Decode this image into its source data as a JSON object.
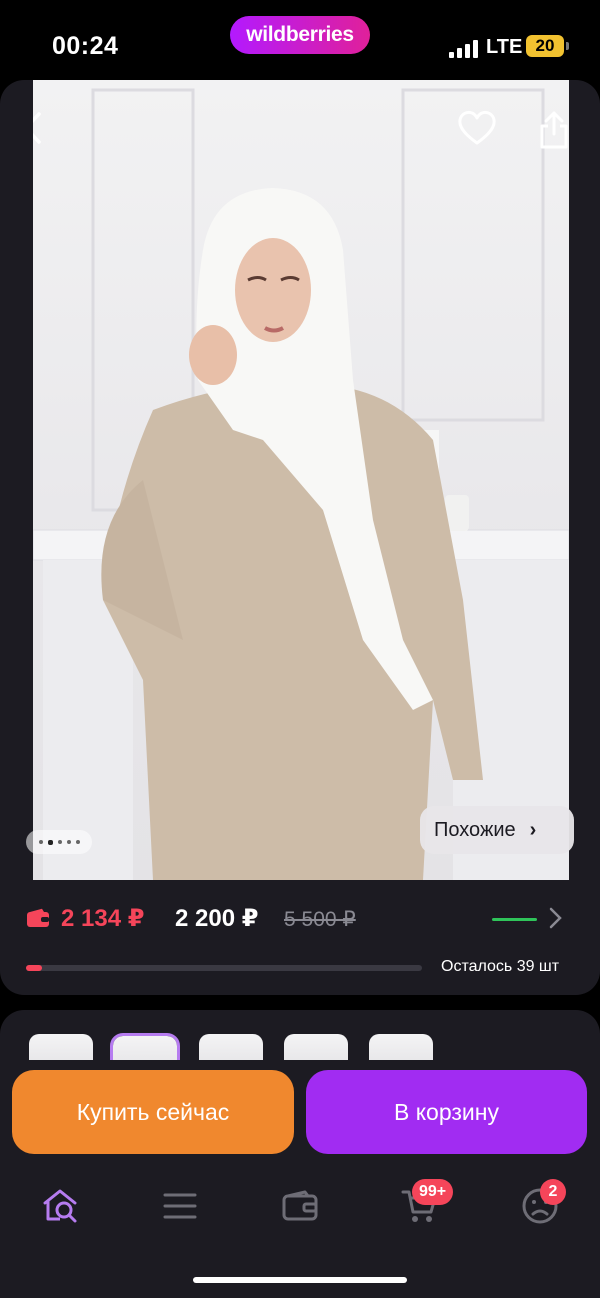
{
  "status_bar": {
    "time": "00:24",
    "brand": "wildberries",
    "network": "LTE",
    "battery": "20"
  },
  "product": {
    "similar_label": "Похожие",
    "gallery_dots": 5,
    "active_dot": 1,
    "price_wallet": "2 134 ₽",
    "price": "2 200 ₽",
    "price_old": "5 500 ₽",
    "stock_text": "Осталось 39 шт",
    "stock_level": 0.04
  },
  "actions": {
    "buy_now": "Купить сейчас",
    "add_to_cart": "В корзину"
  },
  "tabbar": {
    "cart_badge": "99+",
    "profile_badge": "2"
  },
  "colors": {
    "accent_purple": "#a12cf2",
    "accent_orange": "#f0882e",
    "price_red": "#f5455a",
    "green": "#2fc45a"
  }
}
